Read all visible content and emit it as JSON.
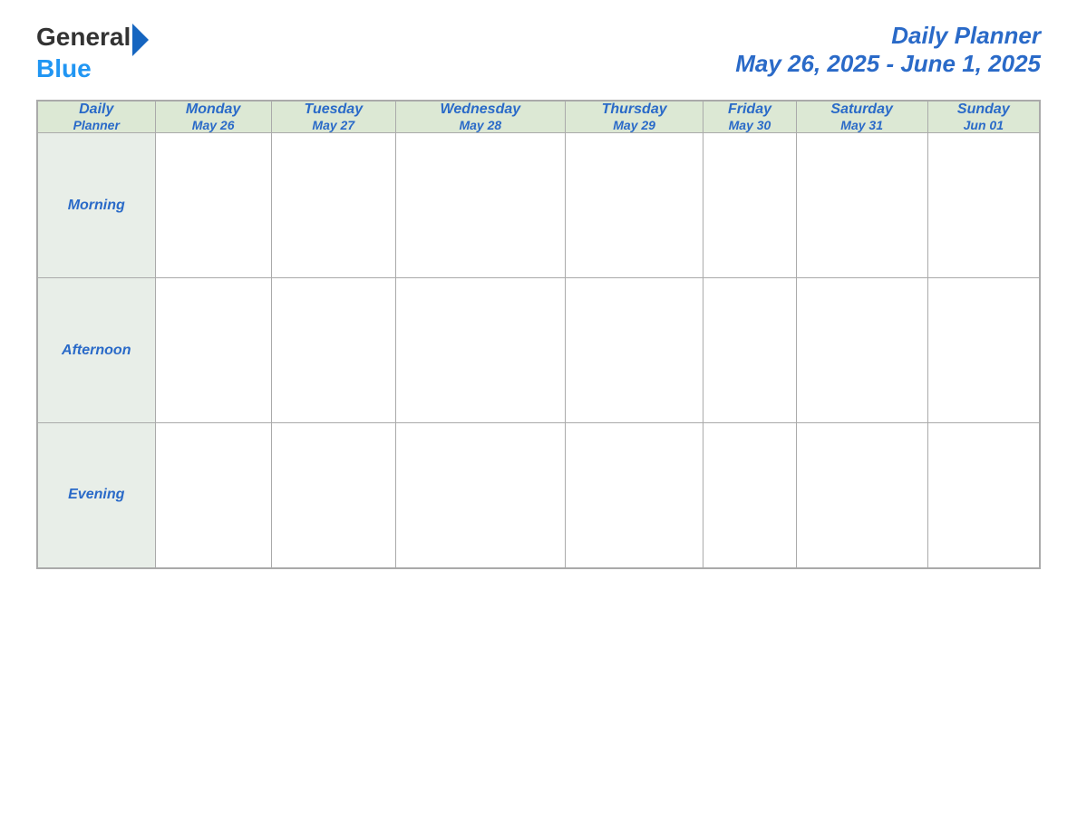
{
  "logo": {
    "general": "General",
    "blue": "Blue"
  },
  "header": {
    "title": "Daily Planner",
    "date_range": "May 26, 2025 - June 1, 2025"
  },
  "table": {
    "label_header": {
      "line1": "Daily",
      "line2": "Planner"
    },
    "days": [
      {
        "name": "Monday",
        "date": "May 26"
      },
      {
        "name": "Tuesday",
        "date": "May 27"
      },
      {
        "name": "Wednesday",
        "date": "May 28"
      },
      {
        "name": "Thursday",
        "date": "May 29"
      },
      {
        "name": "Friday",
        "date": "May 30"
      },
      {
        "name": "Saturday",
        "date": "May 31"
      },
      {
        "name": "Sunday",
        "date": "Jun 01"
      }
    ],
    "rows": [
      {
        "label": "Morning"
      },
      {
        "label": "Afternoon"
      },
      {
        "label": "Evening"
      }
    ]
  }
}
